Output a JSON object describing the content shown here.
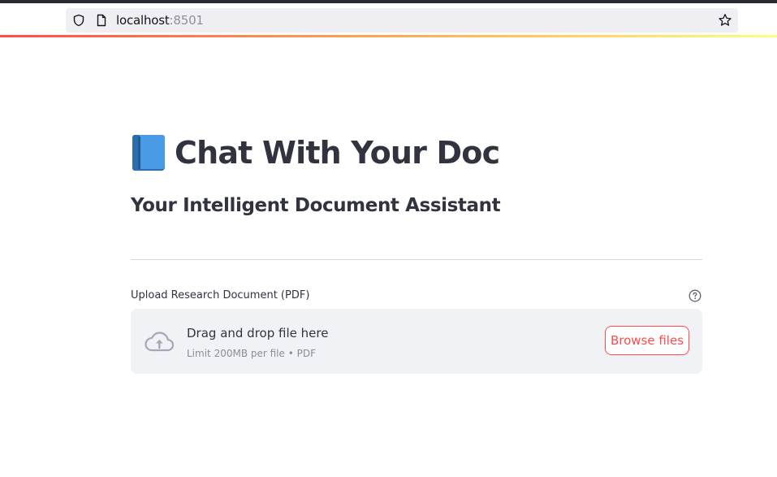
{
  "browser": {
    "url_host": "localhost",
    "url_port": ":8501"
  },
  "header": {
    "title": "Chat With Your Doc",
    "subtitle": "Your Intelligent Document Assistant",
    "icon": "blue-book-icon"
  },
  "uploader": {
    "label": "Upload Research Document (PDF)",
    "drop_text": "Drag and drop file here",
    "limit_text": "Limit 200MB per file • PDF",
    "browse_label": "Browse files",
    "icons": [
      "cloud-upload-icon",
      "help-icon"
    ]
  },
  "colors": {
    "accent": "#ff4b4b",
    "text": "#31333f",
    "dropzone_bg": "#f0f2f6"
  }
}
